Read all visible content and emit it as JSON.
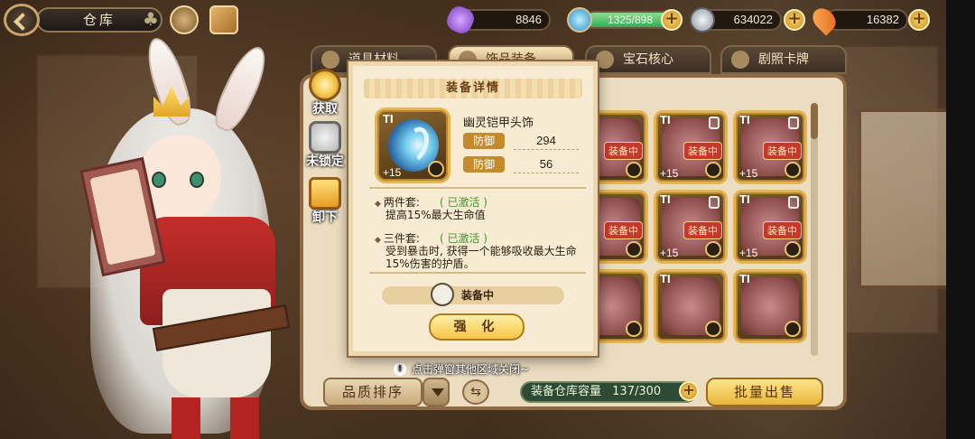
{
  "header": {
    "title": "仓库",
    "icons": [
      "back-icon",
      "clover-icon",
      "compass-icon",
      "book-icon"
    ]
  },
  "resources": [
    {
      "name": "gem",
      "icon": "purple-gem-icon",
      "value": "8846",
      "has_plus": false,
      "color": "#9a5bd6"
    },
    {
      "name": "stamina",
      "icon": "potion-icon",
      "value": "1325/898",
      "has_plus": true,
      "color": "#4fb56a",
      "fill": 1.0
    },
    {
      "name": "coin",
      "icon": "silver-coin-icon",
      "value": "634022",
      "has_plus": true,
      "color": "#b8bcc2"
    },
    {
      "name": "carrot",
      "icon": "carrot-icon",
      "value": "16382",
      "has_plus": true,
      "color": "#f28a2a"
    }
  ],
  "tabs": [
    {
      "label": "道具材料",
      "active": false,
      "icon": "items-icon"
    },
    {
      "label": "饰品装备",
      "active": true,
      "icon": "accessory-icon"
    },
    {
      "label": "宝石核心",
      "active": false,
      "icon": "gem-core-icon"
    },
    {
      "label": "剧照卡牌",
      "active": false,
      "icon": "card-icon"
    }
  ],
  "side_actions": [
    {
      "label": "获取",
      "icon": "magnifier-icon"
    },
    {
      "label": "未锁定",
      "icon": "unlock-icon"
    },
    {
      "label": "卸下",
      "icon": "unequip-icon"
    }
  ],
  "grid": {
    "slots": [
      {
        "tier": "TI",
        "plus": "+15",
        "badge": "装备中",
        "locked": false
      },
      {
        "tier": "TI",
        "plus": "+15",
        "badge": "装备中",
        "locked": true
      },
      {
        "tier": "TI",
        "plus": "+15",
        "badge": "装备中",
        "locked": true
      },
      {
        "tier": "TI",
        "plus": "",
        "badge": "装备中",
        "locked": false
      },
      {
        "tier": "TI",
        "plus": "+15",
        "badge": "装备中",
        "locked": true
      },
      {
        "tier": "TI",
        "plus": "+15",
        "badge": "装备中",
        "locked": true
      },
      {
        "tier": "TI",
        "plus": "",
        "badge": "",
        "locked": false
      },
      {
        "tier": "TI",
        "plus": "",
        "badge": "",
        "locked": false
      },
      {
        "tier": "TI",
        "plus": "",
        "badge": "",
        "locked": false
      }
    ]
  },
  "footer": {
    "sort_label": "品质排序",
    "capacity_label": "装备仓库容量",
    "capacity_value": "137/300",
    "bulk_sell_label": "批量出售"
  },
  "modal": {
    "title": "装备详情",
    "item_name": "幽灵铠甲头饰",
    "item_tier": "TI",
    "item_plus": "+15",
    "stats": [
      {
        "label": "防御",
        "value": "294"
      },
      {
        "label": "防御",
        "value": "56"
      }
    ],
    "sets": [
      {
        "name": "两件套:",
        "status": "( 已激活 )",
        "desc": "提高15%最大生命值"
      },
      {
        "name": "三件套:",
        "status": "( 已激活 )",
        "desc": "受到暴击时, 获得一个能够吸收最大生命15%伤害的护盾。"
      }
    ],
    "equipped_label": "装备中",
    "enhance_label": "强 化",
    "close_hint": "点击弹窗其他区域关闭~"
  }
}
